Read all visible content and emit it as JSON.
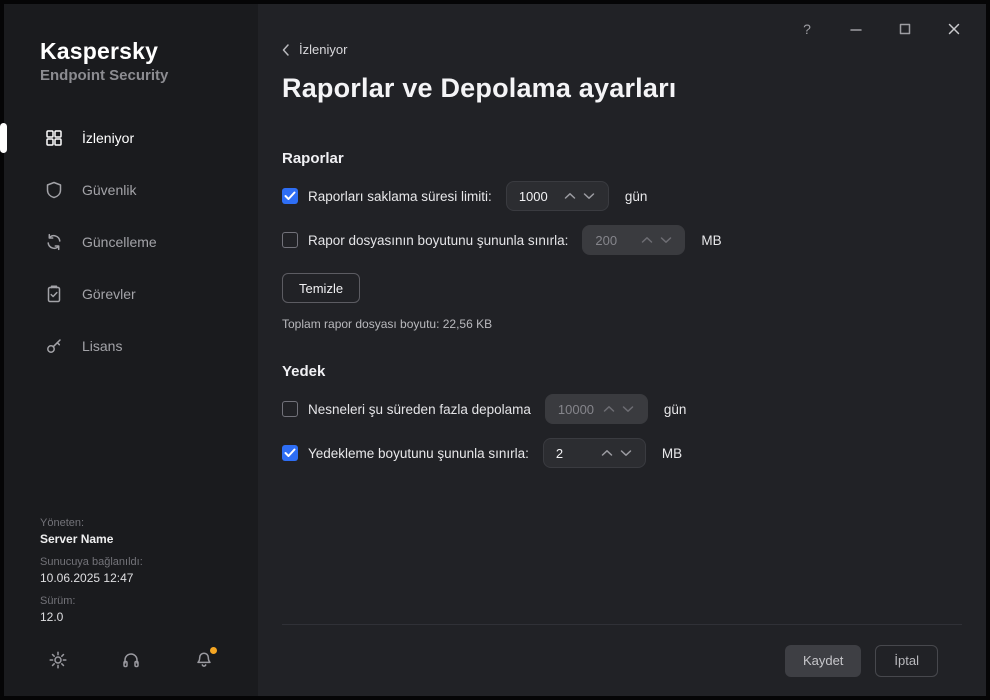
{
  "window": {
    "title_controls": {
      "help": "?"
    }
  },
  "sidebar": {
    "brand_title": "Kaspersky",
    "brand_subtitle": "Endpoint Security",
    "items": [
      {
        "label": "İzleniyor",
        "icon": "monitoring-grid-icon",
        "active": true
      },
      {
        "label": "Güvenlik",
        "icon": "shield-icon",
        "active": false
      },
      {
        "label": "Güncelleme",
        "icon": "update-refresh-icon",
        "active": false
      },
      {
        "label": "Görevler",
        "icon": "tasks-clipboard-icon",
        "active": false
      },
      {
        "label": "Lisans",
        "icon": "license-key-icon",
        "active": false
      }
    ],
    "info": {
      "managed_by_label": "Yöneten:",
      "managed_by_value": "Server Name",
      "connected_label": "Sunucuya bağlanıldı:",
      "connected_value": "10.06.2025 12:47",
      "version_label": "Sürüm:",
      "version_value": "12.0"
    },
    "footer_icons": [
      "settings-gear-icon",
      "support-headset-icon",
      "notifications-bell-icon"
    ],
    "notification_badge": true
  },
  "main": {
    "breadcrumb": {
      "back_label": "İzleniyor"
    },
    "page_title": "Raporlar ve Depolama ayarları",
    "reports": {
      "heading": "Raporlar",
      "rows": [
        {
          "checked": true,
          "enabled": true,
          "label": "Raporları saklama süresi limiti:",
          "value": "1000",
          "unit": "gün"
        },
        {
          "checked": false,
          "enabled": false,
          "label": "Rapor dosyasının boyutunu şununla sınırla:",
          "value": "200",
          "unit": "MB"
        }
      ],
      "clear_button": "Temizle",
      "total_size": "Toplam rapor dosyası boyutu: 22,56 KB"
    },
    "backup": {
      "heading": "Yedek",
      "rows": [
        {
          "checked": false,
          "enabled": false,
          "label": "Nesneleri şu süreden fazla depolama",
          "value": "10000",
          "unit": "gün"
        },
        {
          "checked": true,
          "enabled": true,
          "label": "Yedekleme boyutunu şununla sınırla:",
          "value": "2",
          "unit": "MB"
        }
      ]
    },
    "footer": {
      "save_button": "Kaydet",
      "cancel_button": "İptal"
    }
  },
  "colors": {
    "accent_blue": "#2e6ef5",
    "notification_orange": "#f5a623",
    "sidebar_bg": "#1a1b1e",
    "main_bg": "#212226"
  }
}
